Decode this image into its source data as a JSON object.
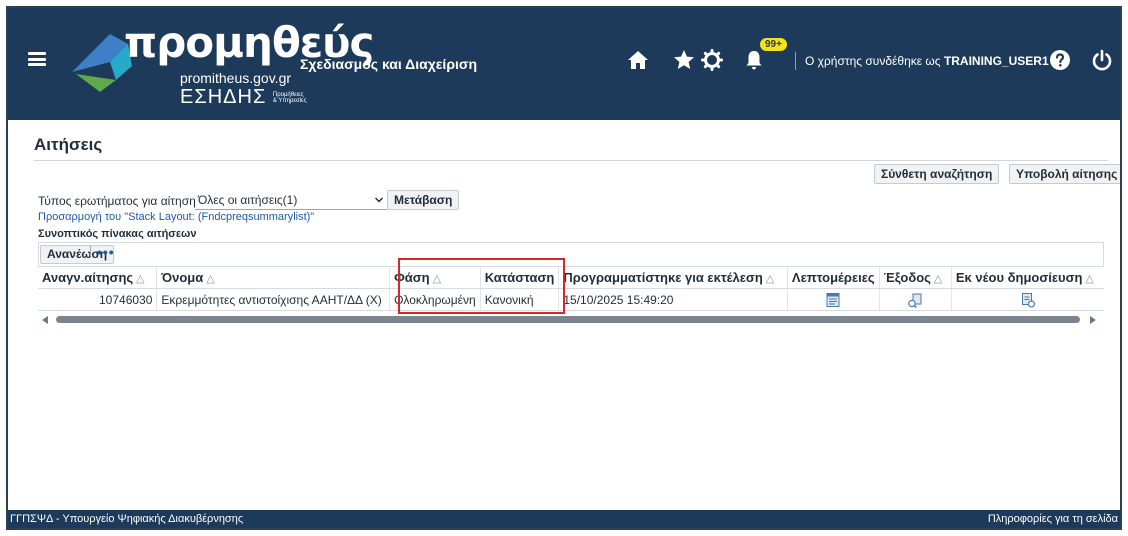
{
  "header": {
    "logo_title": "προμηθεύς",
    "logo_domain": "promitheus.gov.gr",
    "logo_esidis": "ΕΣΗΔΗΣ",
    "logo_esidis_small_1": "Προμήθειες",
    "logo_esidis_small_2": "& Υπηρεσίες",
    "app_title": "Σχεδιασμός και Διαχείριση",
    "notifications_badge": "99+",
    "user_prefix": "Ο χρήστης συνδέθηκε ως",
    "user_name": "TRAINING_USER1",
    "icons": [
      "menu-icon",
      "home-icon",
      "star-icon",
      "gear-icon",
      "bell-icon",
      "help-icon",
      "power-icon"
    ],
    "brand_color": "#1d3a5a",
    "badge_color": "#f7e11b"
  },
  "page": {
    "title": "Αιτήσεις",
    "buttons": {
      "advanced_search": "Σύνθετη αναζήτηση",
      "submit_request": "Υποβολή αίτησης",
      "go": "Μετάβαση",
      "refresh": "Ανανέωση"
    },
    "filter": {
      "label": "Τύπος ερωτήματος για αίτηση",
      "selected": "Όλες οι αιτήσεις(1)"
    },
    "customize_link": "Προσαρμογή του \"Stack Layout: (Fndcpreqsummarylist)\"",
    "section_title": "Συνοπτικός πίνακας αιτήσεων",
    "more_label": "•••"
  },
  "table": {
    "columns": [
      "Αναγν.αίτησης",
      "Όνομα",
      "Φάση",
      "Κατάσταση",
      "Προγραμματίστηκε για εκτέλεση",
      "Λεπτομέρειες",
      "Έξοδος",
      "Εκ νέου δημοσίευση"
    ],
    "sort_glyph": "△",
    "rows": [
      {
        "request_id": "10746030",
        "name": "Εκρεμμότητες αντιστοίχισης ΑΑΗΤ/ΔΔ (X)",
        "phase": "Ολοκληρωμένη",
        "status": "Κανονική",
        "scheduled": "15/10/2025 15:49:20",
        "details_icon": "details-icon",
        "output_icon": "output-icon",
        "republish_icon": "republish-icon"
      }
    ],
    "highlight_color": "#d9262e"
  },
  "footer": {
    "left": "ΓΓΠΣΨΔ - Υπουργείο Ψηφιακής Διακυβέρνησης",
    "right": "Πληροφορίες για τη σελίδα"
  }
}
